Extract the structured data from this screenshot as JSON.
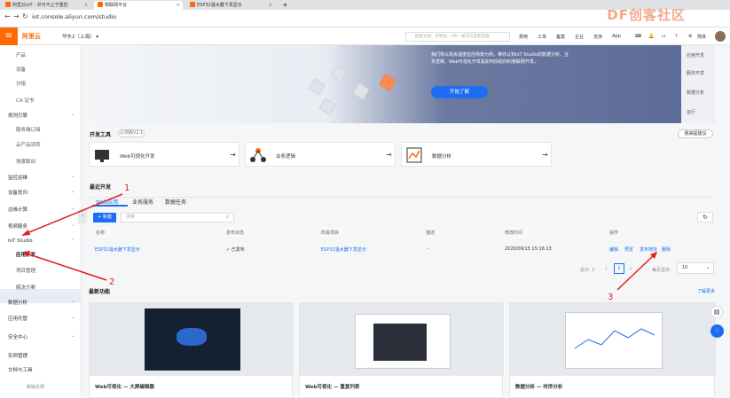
{
  "browser": {
    "tabs": [
      {
        "label": "阿里云IoT - 并可不止于重控"
      },
      {
        "label": "物联网平台"
      },
      {
        "label": "ESP32温水器下发显示"
      }
    ],
    "url": "iot.console.aliyun.com/studio",
    "new_tab": "+"
  },
  "watermark": "DF创客社区",
  "header": {
    "menu_icon": "≡",
    "logo": "阿里云",
    "region": "华东2（上海）",
    "search_placeholder": "搜索文档、控制台、API、解决方案和资源",
    "nav": [
      "费用",
      "工单",
      "备案",
      "企业",
      "支持",
      "App"
    ],
    "lang": "简体"
  },
  "sidebar": {
    "items": [
      {
        "label": "产品",
        "type": "sub"
      },
      {
        "label": "设备",
        "type": "sub"
      },
      {
        "label": "分组",
        "type": "sub"
      },
      {
        "label": "CA 证书",
        "type": "sub"
      },
      {
        "label": "规则引擎",
        "type": "group"
      },
      {
        "label": "服务端订阅",
        "type": "sub"
      },
      {
        "label": "云产品流转",
        "type": "sub"
      },
      {
        "label": "场景联动",
        "type": "sub"
      },
      {
        "label": "监控运维",
        "type": "group"
      },
      {
        "label": "设备划归",
        "type": "group"
      },
      {
        "label": "边缘计算",
        "type": "group"
      },
      {
        "label": "视频服务",
        "type": "group"
      },
      {
        "label": "IoT Studio",
        "type": "group"
      },
      {
        "label": "应用开发",
        "type": "sub"
      },
      {
        "label": "项目管理",
        "type": "sub"
      },
      {
        "label": "解决方案",
        "type": "sub"
      },
      {
        "label": "数据分析",
        "type": "group"
      },
      {
        "label": "应用托管",
        "type": "group"
      },
      {
        "label": "安全中心",
        "type": "group"
      },
      {
        "label": "实例管理",
        "type": "plain"
      },
      {
        "label": "文档与工具",
        "type": "plain"
      }
    ],
    "footer": "新版反馈"
  },
  "banner": {
    "text": "我们将以机房温度监控场景为例，带你认知IoT Studio的数据分析、业务逻辑、Web可视化开发是如何协助你的物联网开发。",
    "button": "开始了解",
    "side_items": [
      "应用开发",
      "服务开发",
      "数据分析",
      "运行"
    ]
  },
  "devtools": {
    "title": "开发工具",
    "badge": "公测版V2.1",
    "feedback": "我来提建议",
    "tools": [
      {
        "label": "Web可视化开发",
        "arrow": "→"
      },
      {
        "label": "业务逻辑",
        "arrow": "→"
      },
      {
        "label": "数据分析",
        "arrow": "→"
      }
    ]
  },
  "recent": {
    "title": "最近开发",
    "tabs": [
      "Web应用",
      "业务服务",
      "数据任务"
    ],
    "new_button": "+ 新建",
    "search_placeholder": "搜索",
    "columns": [
      "名称",
      "发布状态",
      "所属项目",
      "描述",
      "修改时间",
      "操作"
    ],
    "rows": [
      {
        "name": "ESP32温水器下发显示",
        "status": "已发布",
        "project": "ESP32温水器下发显示",
        "desc": "-",
        "time": "2020/09/15 15:16:13",
        "actions": [
          "编辑",
          "预览",
          "发布地址",
          "删除"
        ]
      }
    ],
    "pagination": {
      "total": "总计: 1",
      "page": "1",
      "page_size_label": "每页显示:",
      "page_size": "10"
    }
  },
  "features": {
    "title": "最新功能",
    "more": "了解更多",
    "cards": [
      {
        "label": "Web可视化 — 大屏编辑器"
      },
      {
        "label": "Web可视化 — 重复列表"
      },
      {
        "label": "数据分析 — 时序分析"
      }
    ]
  },
  "annotations": [
    "1",
    "2",
    "3"
  ]
}
